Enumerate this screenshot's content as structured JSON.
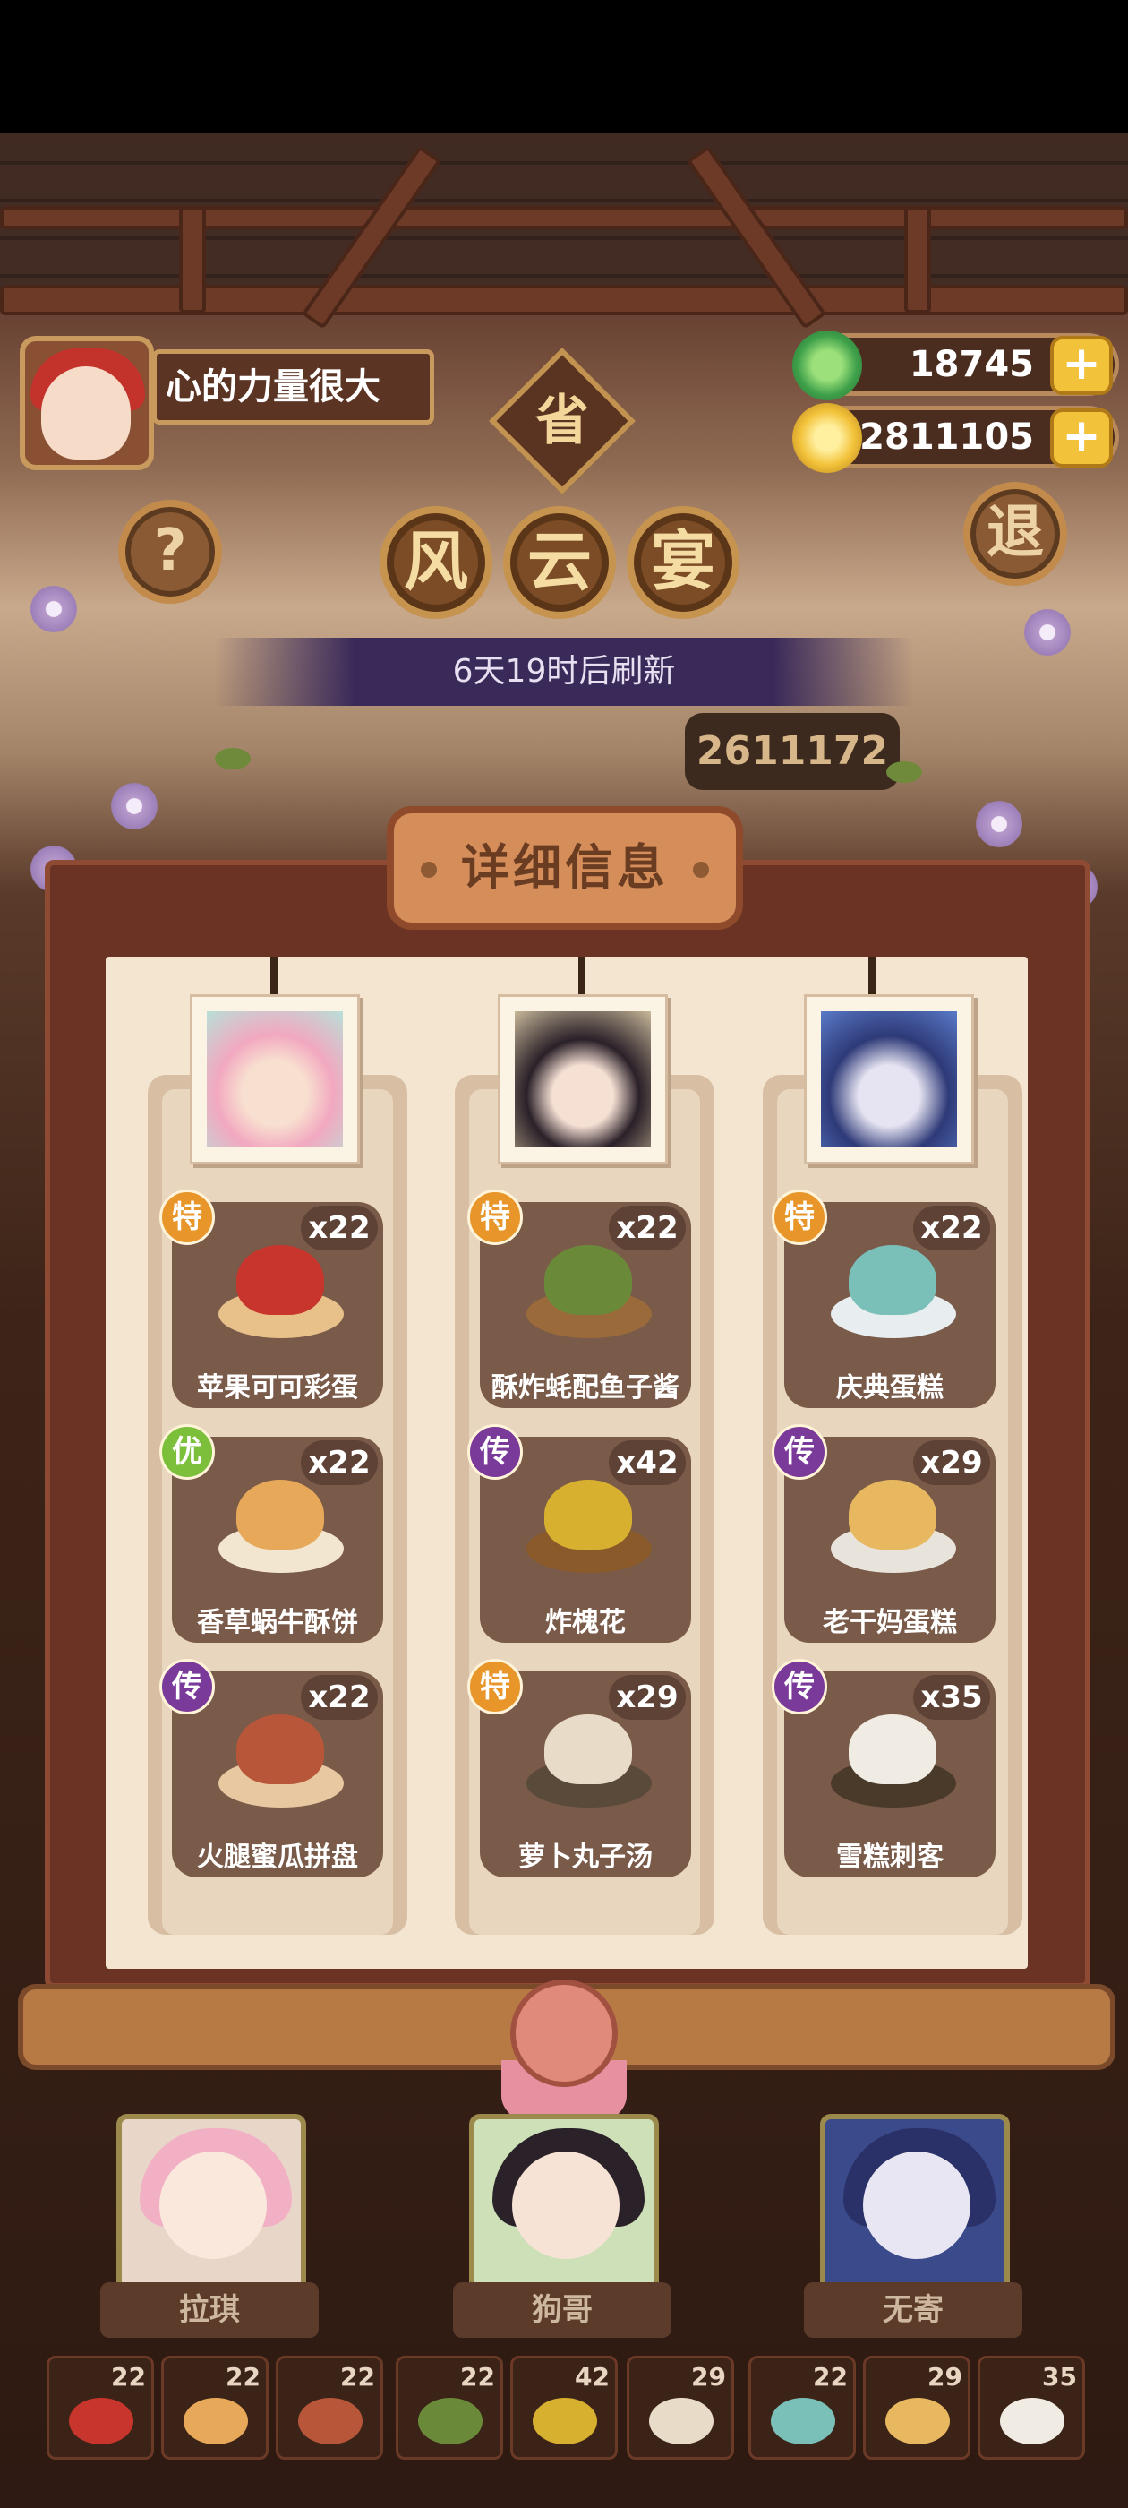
{
  "header": {
    "player_name": "心的力量很大",
    "jade_amount": "18745",
    "coin_amount": "2811105",
    "plus_glyph": "+",
    "help_glyph": "?",
    "exit_label": "退",
    "province_label": "省"
  },
  "event": {
    "title_chars": [
      "风",
      "云",
      "宴"
    ],
    "refresh_text": "6天19时后刷新",
    "score_partial": "2611172"
  },
  "details": {
    "title": "详细信息",
    "columns": [
      {
        "character": "拉琪",
        "dishes": [
          {
            "grade": "特",
            "name": "苹果可可彩蛋",
            "qty": "x22"
          },
          {
            "grade": "优",
            "name": "香草蜗牛酥饼",
            "qty": "x22"
          },
          {
            "grade": "传",
            "name": "火腿蜜瓜拼盘",
            "qty": "x22"
          }
        ]
      },
      {
        "character": "狗哥",
        "dishes": [
          {
            "grade": "特",
            "name": "酥炸蚝配鱼子酱",
            "qty": "x22"
          },
          {
            "grade": "传",
            "name": "炸槐花",
            "qty": "x42"
          },
          {
            "grade": "特",
            "name": "萝卜丸子汤",
            "qty": "x29"
          }
        ]
      },
      {
        "character": "无寄",
        "dishes": [
          {
            "grade": "特",
            "name": "庆典蛋糕",
            "qty": "x22"
          },
          {
            "grade": "传",
            "name": "老干妈蛋糕",
            "qty": "x29"
          },
          {
            "grade": "传",
            "name": "雪糕刺客",
            "qty": "x35"
          }
        ]
      }
    ]
  },
  "characters": [
    "拉琪",
    "狗哥",
    "无寄"
  ],
  "bottom_slots": [
    "22",
    "22",
    "22",
    "22",
    "42",
    "29",
    "22",
    "29",
    "35"
  ],
  "colors": {
    "grade_te": "#e8952a",
    "grade_you": "#7cbf3a",
    "grade_chuan": "#7a3a9a"
  }
}
